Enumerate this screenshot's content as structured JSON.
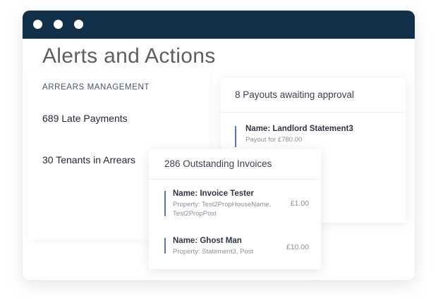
{
  "window": {
    "controls": [
      "window-dot",
      "window-dot",
      "window-dot"
    ]
  },
  "page": {
    "title": "Alerts and Actions"
  },
  "arrears": {
    "heading": "ARREARS MANAGEMENT",
    "late_payments": "689 Late Payments",
    "tenants_in_arrears": "30 Tenants in Arrears"
  },
  "payouts": {
    "heading": "8 Payouts awaiting approval",
    "items": [
      {
        "title": "Name: Landlord Statement3",
        "subtitle": "Payout for £780.00"
      }
    ]
  },
  "invoices": {
    "heading": "286 Outstanding Invoices",
    "items": [
      {
        "title": "Name: Invoice Tester",
        "property_line1": "Property: Test2PropHouseName,",
        "property_line2": "Test2PropPost",
        "amount": "£1.00"
      },
      {
        "title": "Name: Ghost Man",
        "property_line1": "Property: Statement3, Post",
        "amount": "£10.00"
      }
    ]
  },
  "colors": {
    "titlebar": "#12304a",
    "accent_bar": "#5b6fd6"
  }
}
